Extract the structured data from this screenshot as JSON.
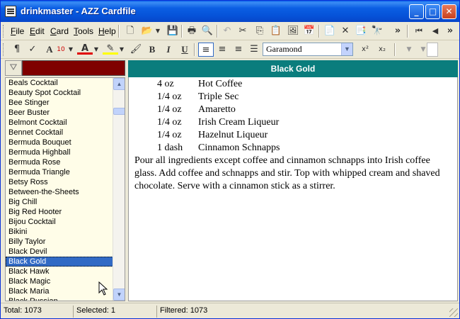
{
  "window": {
    "title": "drinkmaster - AZZ Cardfile",
    "buttons": {
      "minimize": "_",
      "maximize": "□",
      "close": "✕"
    }
  },
  "menu": {
    "items": [
      {
        "label": "File",
        "accel": "F"
      },
      {
        "label": "Edit",
        "accel": "E"
      },
      {
        "label": "Card",
        "accel": "C"
      },
      {
        "label": "Tools",
        "accel": "T"
      },
      {
        "label": "Help",
        "accel": "H"
      }
    ]
  },
  "toolbar": {
    "overflow": "»",
    "font_size": "10",
    "font_name": "Garamond",
    "superscript": "x²",
    "subscript": "x₂",
    "bold": "B",
    "italic": "I",
    "underline": "U"
  },
  "card_list": {
    "items": [
      "Beals Cocktail",
      "Beauty Spot Cocktail",
      "Bee Stinger",
      "Beer Buster",
      "Belmont Cocktail",
      "Bennet Cocktail",
      "Bermuda Bouquet",
      "Bermuda Highball",
      "Bermuda Rose",
      "Bermuda Triangle",
      "Betsy Ross",
      "Between-the-Sheets",
      "Big Chill",
      "Big Red Hooter",
      "Bijou Cocktail",
      "Bikini",
      "Billy Taylor",
      "Black Devil",
      "Black Gold",
      "Black Hawk",
      "Black Magic",
      "Black Maria",
      "Black Russian"
    ],
    "selected_index": 18
  },
  "card": {
    "title": "Black Gold",
    "ingredients": [
      {
        "qty": "4 oz",
        "name": "Hot Coffee"
      },
      {
        "qty": "1/4 oz",
        "name": "Triple Sec"
      },
      {
        "qty": "1/4 oz",
        "name": "Amaretto"
      },
      {
        "qty": "1/4 oz",
        "name": "Irish Cream Liqueur"
      },
      {
        "qty": "1/4 oz",
        "name": "Hazelnut Liqueur"
      },
      {
        "qty": "1 dash",
        "name": "Cinnamon Schnapps"
      }
    ],
    "instructions": [
      "Pour all ingredients except coffee and cinnamon schnapps into Irish coffee",
      "glass. Add coffee and schnapps and stir. Top with whipped cream and shaved",
      "chocolate. Serve with a cinnamon stick as a stirrer."
    ]
  },
  "status": {
    "total": "Total: 1073",
    "selected": "Selected: 1",
    "filtered": "Filtered: 1073"
  },
  "colors": {
    "header_bg": "#0a7d7d",
    "filter_bg": "#7f0000",
    "list_bg": "#fffde8",
    "selection": "#316ac5"
  }
}
